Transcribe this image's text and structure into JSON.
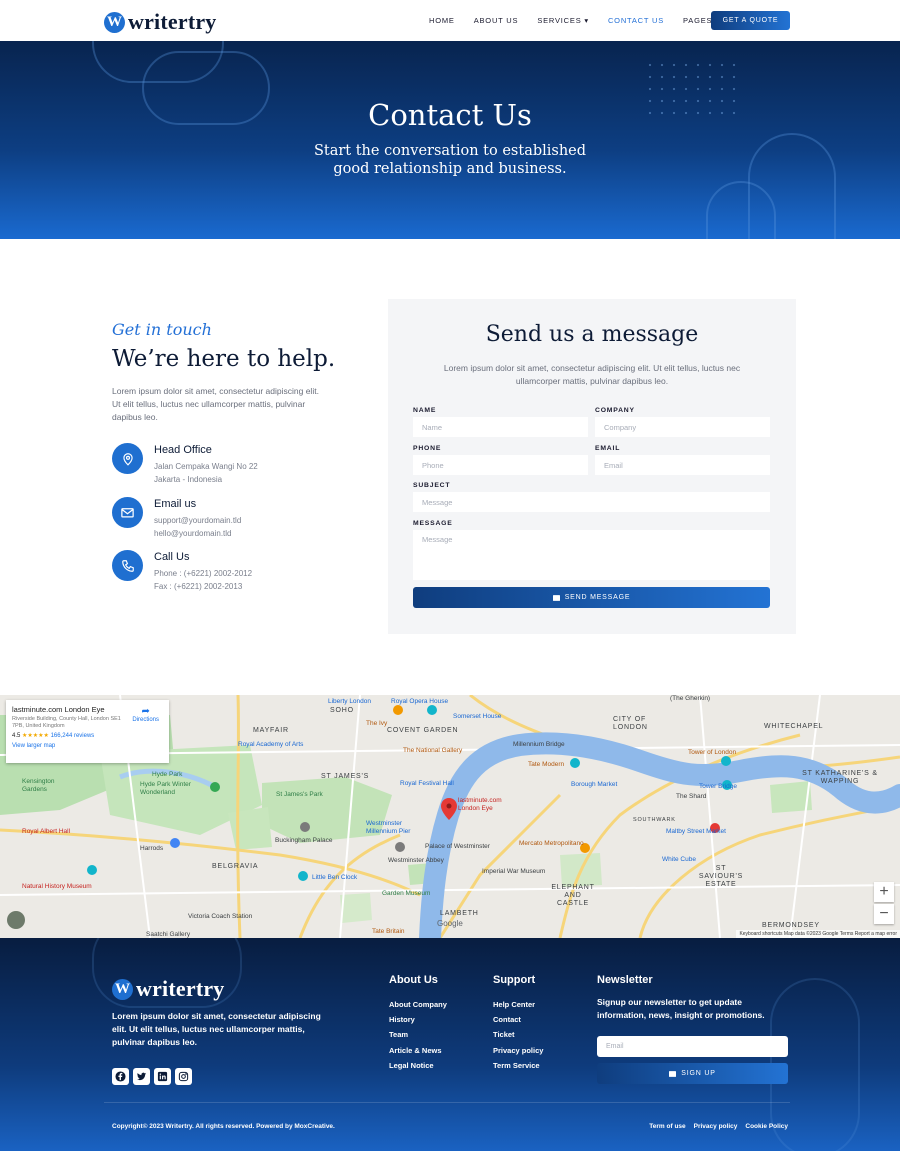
{
  "brand": {
    "logo_letter": "W",
    "name": "writertry"
  },
  "nav": {
    "items": [
      {
        "label": "HOME"
      },
      {
        "label": "ABOUT US"
      },
      {
        "label": "SERVICES ▾"
      },
      {
        "label": "CONTACT US",
        "active": true
      },
      {
        "label": "PAGES ▾"
      }
    ],
    "cta": "GET A QUOTE"
  },
  "hero": {
    "title": "Contact Us",
    "subtitle_line1": "Start the conversation to established",
    "subtitle_line2": "good relationship and business."
  },
  "contact": {
    "eyebrow": "Get in touch",
    "headline": "We’re here to help.",
    "intro": "Lorem ipsum dolor sit amet, consectetur adipiscing elit. Ut elit tellus, luctus nec ullamcorper mattis, pulvinar dapibus leo.",
    "items": [
      {
        "icon": "location-pin-icon",
        "title": "Head Office",
        "line1": "Jalan Cempaka Wangi No 22",
        "line2": "Jakarta - Indonesia"
      },
      {
        "icon": "mail-icon",
        "title": "Email us",
        "line1": "support@yourdomain.tld",
        "line2": "hello@yourdomain.tld"
      },
      {
        "icon": "phone-icon",
        "title": "Call Us",
        "line1": "Phone : (+6221) 2002-2012",
        "line2": "Fax : (+6221) 2002-2013"
      }
    ]
  },
  "form": {
    "title": "Send us a message",
    "description": "Lorem ipsum dolor sit amet, consectetur adipiscing elit. Ut elit tellus, luctus nec ullamcorper mattis, pulvinar dapibus leo.",
    "fields": {
      "name": {
        "label": "NAME",
        "placeholder": "Name",
        "value": ""
      },
      "company": {
        "label": "COMPANY",
        "placeholder": "Company",
        "value": ""
      },
      "phone": {
        "label": "PHONE",
        "placeholder": "Phone",
        "value": ""
      },
      "email": {
        "label": "EMAIL",
        "placeholder": "Email",
        "value": ""
      },
      "subject": {
        "label": "SUBJECT",
        "placeholder": "Message",
        "value": ""
      },
      "message": {
        "label": "MESSAGE",
        "placeholder": "Message",
        "value": ""
      }
    },
    "submit": "SEND MESSAGE"
  },
  "map": {
    "popup": {
      "title": "lastminute.com London Eye",
      "address": "Riverside Building, County Hall, London SE1 7PB, United Kingdom",
      "rating": "4.5",
      "stars": "★★★★★",
      "reviews": "166,244 reviews",
      "larger_map": "View larger map",
      "directions": "Directions"
    },
    "labels": {
      "soho": "SOHO",
      "mayfair": "MAYFAIR",
      "covent_garden": "COVENT GARDEN",
      "st_james": "ST JAMES'S",
      "belgravia": "BELGRAVIA",
      "city_of_london": "CITY OF LONDON",
      "southwark": "SOUTHWARK",
      "lambeth": "LAMBETH",
      "elephant_castle": "ELEPHANT AND CASTLE",
      "st_saviours": "ST SAVIOUR'S ESTATE",
      "st_katharines": "ST KATHARINE'S & WAPPING",
      "bermondsey": "BERMONDSEY",
      "whitechapel": "WHITECHAPEL",
      "kensington_gardens": "Kensington Gardens",
      "hyde_park": "Hyde Park",
      "hyde_park_winter": "Hyde Park Winter Wonderland",
      "royal_albert_hall": "Royal Albert Hall",
      "harrods": "Harrods",
      "natural_history": "Natural History Museum",
      "victoria_coach": "Victoria Coach Station",
      "buckingham": "Buckingham Palace",
      "st_james_park": "St James's Park",
      "royal_academy": "Royal Academy of Arts",
      "national_gallery": "The National Gallery",
      "royal_festival": "Royal Festival Hall",
      "westminster_pier": "Westminster Millennium Pier",
      "palace_westminster": "Palace of Westminster",
      "westminster_abbey": "Westminster Abbey",
      "little_ben": "Little Ben Clock",
      "imperial_war": "Imperial War Museum",
      "garden_museum": "Garden Museum",
      "tate_britain": "Tate Britain",
      "london_eye_pin": "lastminute.com London Eye",
      "mercato": "Mercato Metropolitano",
      "borough_market": "Borough Market",
      "tate_modern": "Tate Modern",
      "millennium_bridge": "Millennium Bridge",
      "tower_of_london": "Tower of London",
      "tower_bridge": "Tower Bridge",
      "the_shard": "The Shard",
      "white_cube": "White Cube",
      "maltby": "Maltby Street Market",
      "liberty": "Liberty London",
      "royal_opera": "Royal Opera House",
      "somerset": "Somerset House",
      "the_ivy": "The Ivy",
      "gherkin": "(The Gherkin)",
      "saatchi": "Saatchi Gallery",
      "google": "Google"
    },
    "zoom_in": "+",
    "zoom_out": "−",
    "attribution": "Keyboard shortcuts   Map data ©2023 Google   Terms   Report a map error"
  },
  "footer": {
    "about": "Lorem ipsum dolor sit amet, consectetur adipiscing elit. Ut elit tellus, luctus nec ullamcorper mattis, pulvinar dapibus leo.",
    "columns": [
      {
        "title": "About Us",
        "links": [
          "About Company",
          "History",
          "Team",
          "Article & News",
          "Legal Notice"
        ]
      },
      {
        "title": "Support",
        "links": [
          "Help Center",
          "Contact",
          "Ticket",
          "Privacy policy",
          "Term Service"
        ]
      }
    ],
    "newsletter": {
      "title": "Newsletter",
      "text": "Signup our newsletter to get update information, news, insight or promotions.",
      "placeholder": "Email",
      "button": "SIGN UP"
    },
    "copyright": "Copyright© 2023 Writertry. All rights reserved. Powered by MoxCreative.",
    "legal": [
      "Term of use",
      "Privacy policy",
      "Cookie Policy"
    ]
  },
  "colors": {
    "primary": "#1f6fd0",
    "dark_navy": "#08244f",
    "accent_text": "#2470d6"
  }
}
